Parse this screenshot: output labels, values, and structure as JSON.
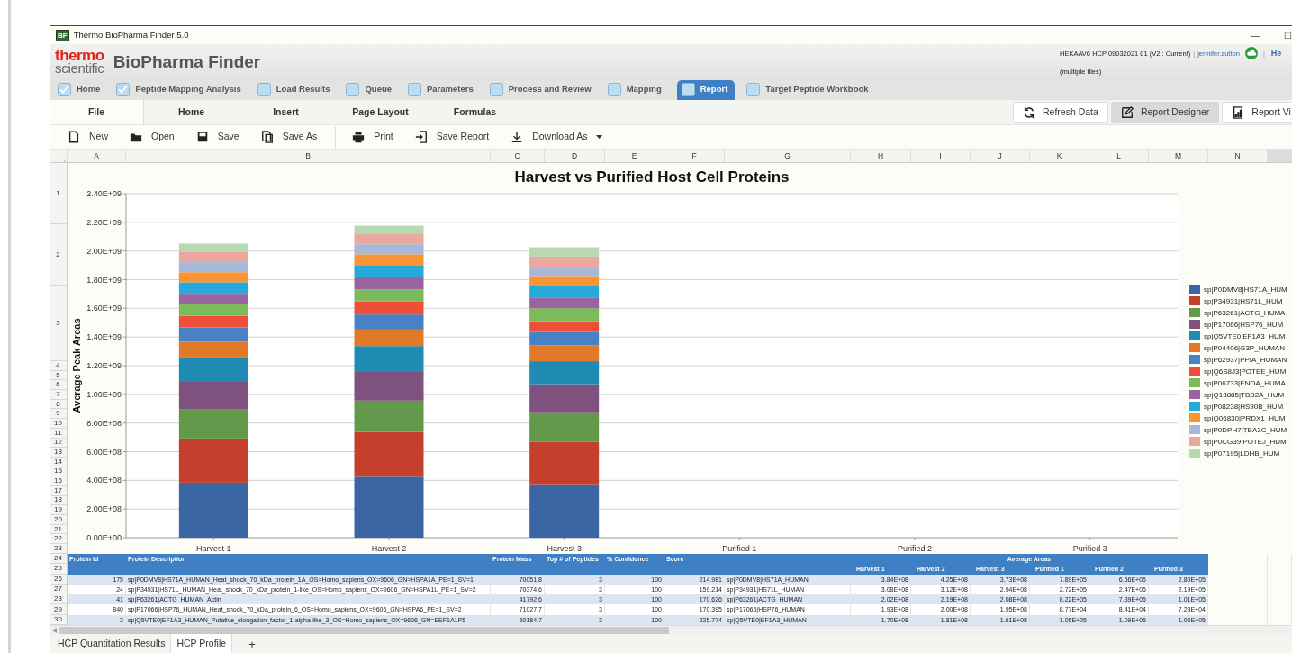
{
  "window": {
    "app_icon": "BF",
    "title": "Thermo BioPharma Finder 5.0",
    "controls": [
      "—",
      "☐"
    ]
  },
  "header": {
    "logo_top": "thermo",
    "logo_bottom": "scientific",
    "app_name": "BioPharma Finder",
    "project": "HEKAAV6 HCP 09032021 01 (V2 : Current)",
    "files": "(multiple files)",
    "separators": [
      "|",
      "|"
    ],
    "user": "jennifer.sutton",
    "help": "He"
  },
  "workflow_tabs": [
    {
      "label": "Home",
      "checked": true,
      "selected": false
    },
    {
      "label": "Peptide Mapping Analysis",
      "checked": true,
      "selected": false
    },
    {
      "label": "Load Results",
      "checked": false,
      "selected": false
    },
    {
      "label": "Queue",
      "checked": false,
      "selected": false
    },
    {
      "label": "Parameters",
      "checked": false,
      "selected": false
    },
    {
      "label": "Process and Review",
      "checked": false,
      "selected": false
    },
    {
      "label": "Mapping",
      "checked": false,
      "selected": false
    },
    {
      "label": "Report",
      "checked": false,
      "selected": true
    },
    {
      "label": "Target Peptide Workbook",
      "checked": false,
      "selected": false
    }
  ],
  "ribbon_tabs": [
    {
      "label": "File",
      "selected": true
    },
    {
      "label": "Home",
      "selected": false
    },
    {
      "label": "Insert",
      "selected": false
    },
    {
      "label": "Page Layout",
      "selected": false
    },
    {
      "label": "Formulas",
      "selected": false
    }
  ],
  "view_buttons": [
    {
      "label": "Refresh Data",
      "selected": false
    },
    {
      "label": "Report Designer",
      "selected": true
    },
    {
      "label": "Report Vi",
      "selected": false
    }
  ],
  "toolbar": [
    {
      "label": "New",
      "dropdown": false
    },
    {
      "label": "Open",
      "dropdown": false
    },
    {
      "label": "Save",
      "dropdown": false
    },
    {
      "label": "Save As",
      "dropdown": false
    },
    {
      "label": "Print",
      "dropdown": false
    },
    {
      "label": "Save Report",
      "dropdown": false
    },
    {
      "label": "Download As",
      "dropdown": true
    }
  ],
  "sheet": {
    "columns": [
      "A",
      "B",
      "C",
      "D",
      "E",
      "F",
      "G",
      "H",
      "I",
      "J",
      "K",
      "L",
      "M",
      "N"
    ],
    "chart_rows": [
      "1",
      "2",
      "3",
      "4",
      "5",
      "6",
      "7",
      "8",
      "9",
      "10",
      "11",
      "12",
      "13",
      "14",
      "15",
      "16",
      "17",
      "18",
      "19",
      "20",
      "21",
      "22",
      "23"
    ]
  },
  "chart": {
    "chart_data": {
      "type": "bar",
      "stacked": true,
      "grid": true,
      "legend": "right",
      "title": "Harvest vs Purified Host Cell Proteins",
      "ylabel": "Average Peak Areas",
      "categories": [
        "Harvest 1",
        "Harvest 2",
        "Harvest 3",
        "Purified 1",
        "Purified 2",
        "Purified 3"
      ],
      "ylim": [
        0,
        2400000000.0
      ],
      "yticks": [
        {
          "value": 0,
          "label": "0.00E+00"
        },
        {
          "value": 200000000.0,
          "label": "2.00E+08"
        },
        {
          "value": 400000000.0,
          "label": "4.00E+08"
        },
        {
          "value": 600000000.0,
          "label": "6.00E+08"
        },
        {
          "value": 800000000.0,
          "label": "8.00E+08"
        },
        {
          "value": 1000000000.0,
          "label": "1.00E+09"
        },
        {
          "value": 1200000000.0,
          "label": "1.20E+09"
        },
        {
          "value": 1400000000.0,
          "label": "1.40E+09"
        },
        {
          "value": 1600000000.0,
          "label": "1.60E+09"
        },
        {
          "value": 1800000000.0,
          "label": "1.80E+09"
        },
        {
          "value": 2000000000.0,
          "label": "2.00E+09"
        },
        {
          "value": 2200000000.0,
          "label": "2.20E+09"
        },
        {
          "value": 2400000000.0,
          "label": "2.40E+09"
        }
      ],
      "series": [
        {
          "name": "sp|P0DMV8|HS71A_HUM",
          "color": "#3a67a3",
          "values": [
            384000000.0,
            425000000.0,
            373000000.0,
            0,
            0,
            0
          ]
        },
        {
          "name": "sp|P34931|HS71L_HUM",
          "color": "#c4402d",
          "values": [
            308000000.0,
            312000000.0,
            294000000.0,
            0,
            0,
            0
          ]
        },
        {
          "name": "sp|P63261|ACTG_HUMA",
          "color": "#62994a",
          "values": [
            202000000.0,
            219000000.0,
            208000000.0,
            0,
            0,
            0
          ]
        },
        {
          "name": "sp|P17066|HSP76_HUM",
          "color": "#7f517f",
          "values": [
            193000000.0,
            200000000.0,
            195000000.0,
            0,
            0,
            0
          ]
        },
        {
          "name": "sp|Q5VTE0|EF1A3_HUM",
          "color": "#1f8bb3",
          "values": [
            170000000.0,
            181000000.0,
            161000000.0,
            0,
            0,
            0
          ]
        },
        {
          "name": "sp|P04406|G3P_HUMAN",
          "color": "#e07a28",
          "values": [
            110000000.0,
            115000000.0,
            110000000.0,
            0,
            0,
            0
          ]
        },
        {
          "name": "sp|P62937|PPIA_HUMAN",
          "color": "#4a80c6",
          "values": [
            100000000.0,
            105000000.0,
            95000000.0,
            0,
            0,
            0
          ]
        },
        {
          "name": "sp|Q6S8J3|POTEE_HUM",
          "color": "#ef4f38",
          "values": [
            80000000.0,
            90000000.0,
            75000000.0,
            0,
            0,
            0
          ]
        },
        {
          "name": "sp|P06733|ENOA_HUMA",
          "color": "#7cba5c",
          "values": [
            80000000.0,
            85000000.0,
            90000000.0,
            0,
            0,
            0
          ]
        },
        {
          "name": "sp|Q13885|TBB2A_HUM",
          "color": "#9a64a0",
          "values": [
            75000000.0,
            90000000.0,
            75000000.0,
            0,
            0,
            0
          ]
        },
        {
          "name": "sp|P08238|HS90B_HUM",
          "color": "#27aad9",
          "values": [
            80000000.0,
            80000000.0,
            80000000.0,
            0,
            0,
            0
          ]
        },
        {
          "name": "sp|Q06830|PRDX1_HUM",
          "color": "#fb9534",
          "values": [
            70000000.0,
            75000000.0,
            70000000.0,
            0,
            0,
            0
          ]
        },
        {
          "name": "sp|P0DPH7|TBA3C_HUM",
          "color": "#a8b8d9",
          "values": [
            70000000.0,
            70000000.0,
            65000000.0,
            0,
            0,
            0
          ]
        },
        {
          "name": "sp|P0CG39|POTEJ_HUM",
          "color": "#eba89e",
          "values": [
            70000000.0,
            70000000.0,
            70000000.0,
            0,
            0,
            0
          ]
        },
        {
          "name": "sp|P07195|LDHB_HUM",
          "color": "#b8d8b0",
          "values": [
            60000000.0,
            60000000.0,
            65000000.0,
            0,
            0,
            0
          ]
        }
      ]
    }
  },
  "table": {
    "header_row": {
      "number": "24",
      "cells": [
        "Protein Id",
        "Protein Description",
        "Protein Mass",
        "Top # of Peptides",
        "% Confidence",
        "Score"
      ],
      "group_label": "Average Areas"
    },
    "subheader_row": {
      "number": "25",
      "columns": [
        "Harvest 1",
        "Harvest 2",
        "Harvest 3",
        "Purified 1",
        "Purified 2",
        "Purified 3"
      ]
    },
    "rows": [
      {
        "number": "26",
        "protein_id": "175",
        "description": "sp|P0DMV8|HS71A_HUMAN_Heat_shock_70_kDa_protein_1A_OS=Homo_sapiens_OX=9606_GN=HSPA1A_PE=1_SV=1",
        "mass": "70051.8",
        "peptides": "3",
        "confidence": "100",
        "score": "214.981",
        "name": "sp|P0DMV8|HS71A_HUMAN",
        "areas": [
          "3.84E+08",
          "4.25E+08",
          "3.73E+08",
          "7.89E+05",
          "6.56E+05",
          "2.80E+05"
        ]
      },
      {
        "number": "27",
        "protein_id": "24",
        "description": "sp|P34931|HS71L_HUMAN_Heat_shock_70_kDa_protein_1-like_OS=Homo_sapiens_OX=9606_GN=HSPA1L_PE=1_SV=2",
        "mass": "70374.6",
        "peptides": "3",
        "confidence": "100",
        "score": "159.214",
        "name": "sp|P34931|HS71L_HUMAN",
        "areas": [
          "3.08E+08",
          "3.12E+08",
          "2.94E+08",
          "2.72E+05",
          "2.47E+05",
          "2.19E+05"
        ]
      },
      {
        "number": "28",
        "protein_id": "41",
        "description": "sp|P63261|ACTG_HUMAN_Actin",
        "mass": "41792.6",
        "peptides": "3",
        "confidence": "100",
        "score": "170.626",
        "name": "sp|P63261|ACTG_HUMAN_",
        "areas": [
          "2.02E+08",
          "2.19E+08",
          "2.08E+08",
          "8.22E+05",
          "7.39E+05",
          "1.01E+05"
        ]
      },
      {
        "number": "29",
        "protein_id": "840",
        "description": "sp|P17066|HSP76_HUMAN_Heat_shock_70_kDa_protein_6_OS=Homo_sapiens_OX=9606_GN=HSPA6_PE=1_SV=2",
        "mass": "71027.7",
        "peptides": "3",
        "confidence": "100",
        "score": "170.395",
        "name": "sp|P17066|HSP76_HUMAN",
        "areas": [
          "1.93E+08",
          "2.00E+08",
          "1.95E+08",
          "8.77E+04",
          "8.41E+04",
          "7.28E+04"
        ]
      },
      {
        "number": "30",
        "protein_id": "2",
        "description": "sp|Q5VTE0|EF1A3_HUMAN_Putative_elongation_factor_1-alpha-like_3_OS=Homo_sapiens_OX=9606_GN=EEF1A1P5",
        "mass": "50184.7",
        "peptides": "3",
        "confidence": "100",
        "score": "225.774",
        "name": "sp|Q5VTE0|EF1A3_HUMAN",
        "areas": [
          "1.70E+08",
          "1.81E+08",
          "1.61E+08",
          "1.05E+05",
          "1.09E+05",
          "1.05E+05"
        ]
      }
    ]
  },
  "sheet_tabs": [
    {
      "label": "HCP Quantitation Results",
      "selected": false
    },
    {
      "label": "HCP Profile",
      "selected": true
    }
  ],
  "add_sheet": "+"
}
